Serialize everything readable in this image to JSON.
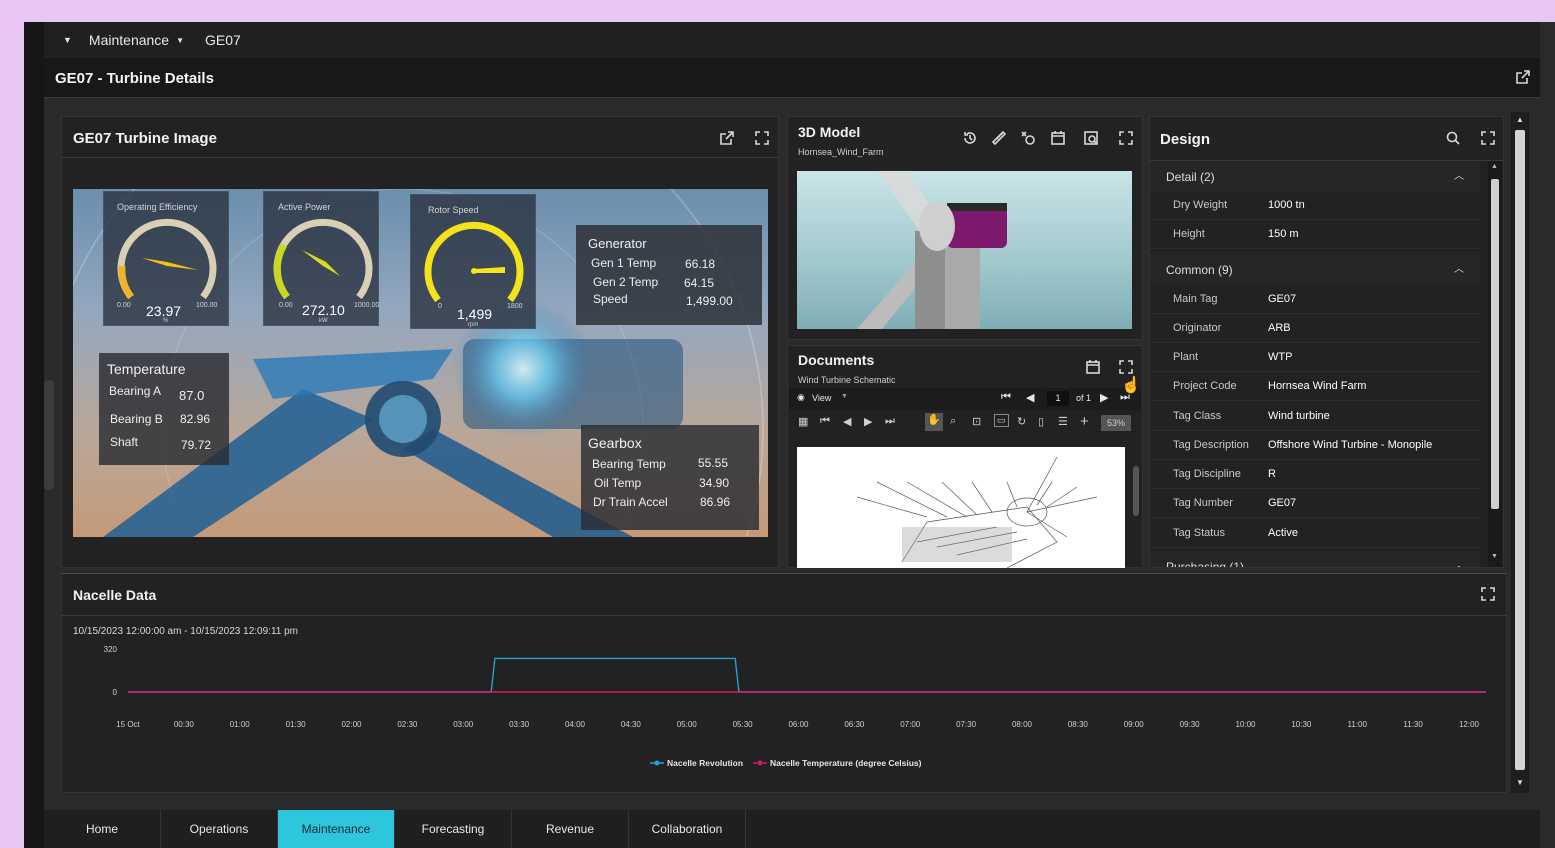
{
  "breadcrumb": {
    "section": "Maintenance",
    "item": "GE07"
  },
  "page_title": "GE07 - Turbine Details",
  "turbine_image": {
    "title": "GE07 Turbine Image",
    "gauges": [
      {
        "label": "Operating Efficiency",
        "value": "23.97",
        "unit": "%",
        "min": "0.00",
        "max": "100.00",
        "fraction": 0.24
      },
      {
        "label": "Active Power",
        "value": "272.10",
        "unit": "kW",
        "min": "0.00",
        "max": "1000.00",
        "fraction": 0.27
      },
      {
        "label": "Rotor Speed",
        "value": "1,499",
        "unit": "rpm",
        "min": "0",
        "max": "1800",
        "fraction": 0.83
      }
    ],
    "generator": {
      "title": "Generator",
      "rows": [
        {
          "k": "Gen 1 Temp",
          "v": "66.18"
        },
        {
          "k": "Gen 2 Temp",
          "v": "64.15"
        },
        {
          "k": "Speed",
          "v": "1,499.00"
        }
      ]
    },
    "temperature": {
      "title": "Temperature",
      "rows": [
        {
          "k": "Bearing A",
          "v": "87.0"
        },
        {
          "k": "Bearing B",
          "v": "82.96"
        },
        {
          "k": "Shaft",
          "v": "79.72"
        }
      ]
    },
    "gearbox": {
      "title": "Gearbox",
      "rows": [
        {
          "k": "Bearing Temp",
          "v": "55.55"
        },
        {
          "k": "Oil Temp",
          "v": "34.90"
        },
        {
          "k": "Dr Train Accel",
          "v": "86.96"
        }
      ]
    }
  },
  "model3d": {
    "title": "3D Model",
    "subtitle": "Hornsea_Wind_Farm"
  },
  "documents": {
    "title": "Documents",
    "subtitle": "Wind Turbine Schematic",
    "view_label": "View",
    "page": "1",
    "of_pages": "of 1",
    "zoom": "53%"
  },
  "design": {
    "title": "Design",
    "sections": [
      {
        "name": "Detail (2)",
        "rows": [
          {
            "k": "Dry Weight",
            "v": "1000 tn"
          },
          {
            "k": "Height",
            "v": "150 m"
          }
        ]
      },
      {
        "name": "Common (9)",
        "rows": [
          {
            "k": "Main Tag",
            "v": "GE07"
          },
          {
            "k": "Originator",
            "v": "ARB"
          },
          {
            "k": "Plant",
            "v": "WTP"
          },
          {
            "k": "Project Code",
            "v": "Hornsea Wind Farm"
          },
          {
            "k": "Tag Class",
            "v": "Wind turbine"
          },
          {
            "k": "Tag Description",
            "v": "Offshore Wind Turbine - Monopile"
          },
          {
            "k": "Tag Discipline",
            "v": "R"
          },
          {
            "k": "Tag Number",
            "v": "GE07"
          },
          {
            "k": "Tag Status",
            "v": "Active"
          }
        ]
      },
      {
        "name": "Purchasing (1)",
        "rows": []
      }
    ]
  },
  "nacelle": {
    "title": "Nacelle Data"
  },
  "chart_data": {
    "type": "line",
    "title": "10/15/2023 12:00:00 am - 10/15/2023 12:09:11 pm",
    "ylim": [
      0,
      320
    ],
    "yticks": [
      "320",
      "0"
    ],
    "x_ticks": [
      "15 Oct",
      "00:30",
      "01:00",
      "01:30",
      "02:00",
      "02:30",
      "03:00",
      "03:30",
      "04:00",
      "04:30",
      "05:00",
      "05:30",
      "06:00",
      "06:30",
      "07:00",
      "07:30",
      "08:00",
      "08:30",
      "09:00",
      "09:30",
      "10:00",
      "10:30",
      "11:00",
      "11:30",
      "12:00"
    ],
    "series": [
      {
        "name": "Nacelle Revolution",
        "color": "#2a9fd6",
        "points": [
          [
            "00:00",
            0
          ],
          [
            "03:15",
            0
          ],
          [
            "03:17",
            250
          ],
          [
            "05:26",
            250
          ],
          [
            "05:28",
            0
          ],
          [
            "12:09",
            0
          ]
        ]
      },
      {
        "name": "Nacelle Temperature (degree Celsius)",
        "color": "#d61a6b",
        "points": [
          [
            "00:00",
            0
          ],
          [
            "06:00",
            0
          ],
          [
            "12:09",
            0
          ]
        ]
      }
    ],
    "legend": "bottom-center"
  },
  "bottom_tabs": [
    "Home",
    "Operations",
    "Maintenance",
    "Forecasting",
    "Revenue",
    "Collaboration"
  ],
  "active_tab": "Maintenance"
}
